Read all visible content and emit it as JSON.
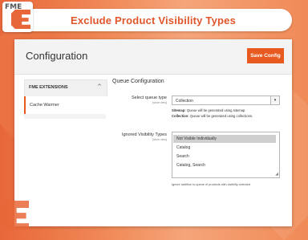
{
  "header": {
    "title": "Exclude Product Visibility Types",
    "logo_text": "FME"
  },
  "page": {
    "title": "Configuration",
    "save_label": "Save Config"
  },
  "sidebar": {
    "section_label": "FME EXTENSIONS",
    "items": [
      {
        "label": "Cache Warmer",
        "active": true
      }
    ]
  },
  "form": {
    "section_title": "Queue Configuration",
    "queue_type": {
      "label": "Select queue type",
      "scope": "[store view]",
      "value": "Collection",
      "notes": [
        {
          "term": "Sitemap:",
          "text": "Queue will be generated using sitemap."
        },
        {
          "term": "Collection:",
          "text": "Queue will be generated using collections."
        }
      ]
    },
    "visibility": {
      "label": "Ignored Visibility Types",
      "scope": "[store view]",
      "options": [
        "Not Visible Individually",
        "Catalog",
        "Search",
        "Catalog, Search"
      ],
      "selected": [
        "Not Visible Individually"
      ],
      "help": "Ignore addition to queue of products with visibility selected"
    }
  },
  "colors": {
    "accent": "#e85a1f",
    "title": "#e0552a",
    "background": "#f08a57"
  }
}
